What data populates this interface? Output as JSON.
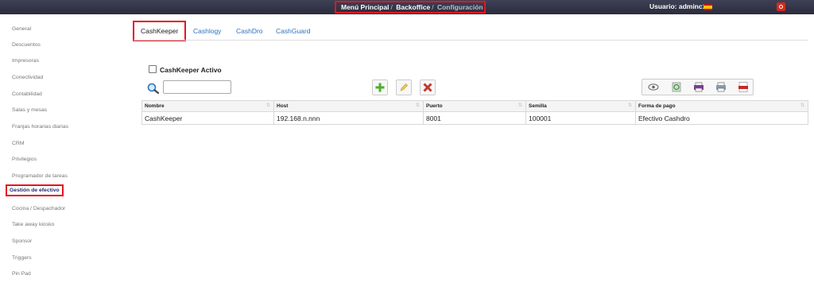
{
  "header": {
    "breadcrumb": [
      "Menú Principal",
      "Backoffice",
      "Configuración"
    ],
    "user_label": "Usuario: adminc1"
  },
  "sidebar": {
    "items": [
      "General",
      "Descuentos",
      "Impresoras",
      "Conectividad",
      "Contabilidad",
      "Salas y mesas",
      "Franjas horarias diarias",
      "CRM",
      "Privilegios",
      "Programador de tareas",
      "Gestión de efectivo",
      "Cocina / Despachador",
      "Take away kiosko",
      "Sponsor",
      "Triggers",
      "Pin Pad"
    ],
    "active_index": 10
  },
  "tabs": [
    "CashKeeper",
    "Cashlogy",
    "CashDro",
    "CashGuard"
  ],
  "active_tab": "CashKeeper",
  "checkbox": {
    "label": "CashKeeper Activo",
    "checked": false
  },
  "search": {
    "value": ""
  },
  "table": {
    "columns": [
      "Nombre",
      "Host",
      "Puerto",
      "Semilla",
      "Forma de pago"
    ],
    "rows": [
      [
        "CashKeeper",
        "192.168.n.nnn",
        "8001",
        "100001",
        "Efectivo Cashdro"
      ]
    ]
  },
  "colors": {
    "topbar": "#2f3142",
    "highlight": "#e4151f",
    "link": "#2a73c2"
  }
}
